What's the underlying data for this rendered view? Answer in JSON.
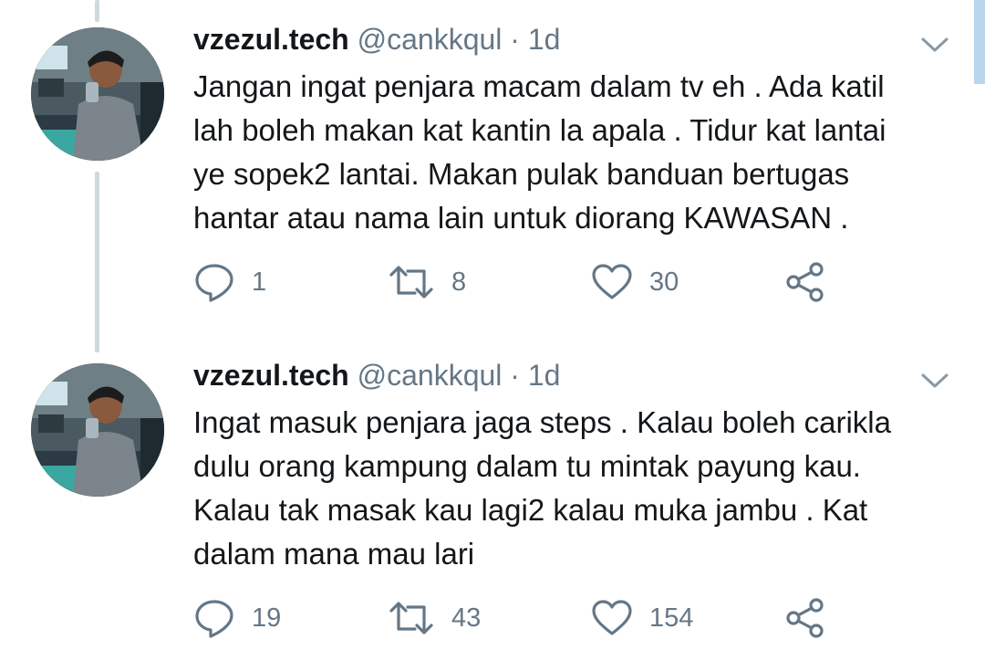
{
  "colors": {
    "text_primary": "#14171a",
    "text_secondary": "#657786",
    "thread_line": "#cfd9de",
    "background": "#ffffff"
  },
  "tweets": [
    {
      "display_name": "vzezul.tech",
      "handle": "@cankkqul",
      "separator": "·",
      "time": "1d",
      "body_lines": [
        "Jangan ingat penjara macam dalam tv eh . Ada katil",
        "lah boleh makan kat kantin la apala . Tidur kat lantai",
        "ye sopek2 lantai. Makan pulak banduan bertugas",
        "hantar atau nama lain untuk diorang KAWASAN ."
      ],
      "replies": "1",
      "retweets": "8",
      "likes": "30",
      "icons": [
        "reply-icon",
        "retweet-icon",
        "like-icon",
        "share-icon",
        "chevron-down-icon"
      ]
    },
    {
      "display_name": "vzezul.tech",
      "handle": "@cankkqul",
      "separator": "·",
      "time": "1d",
      "body_lines": [
        "Ingat masuk penjara jaga steps . Kalau boleh carikla",
        "dulu orang kampung dalam tu mintak payung kau.",
        "Kalau tak masak kau lagi2 kalau muka jambu . Kat",
        "dalam mana mau lari"
      ],
      "replies": "19",
      "retweets": "43",
      "likes": "154",
      "icons": [
        "reply-icon",
        "retweet-icon",
        "like-icon",
        "share-icon",
        "chevron-down-icon"
      ]
    }
  ]
}
